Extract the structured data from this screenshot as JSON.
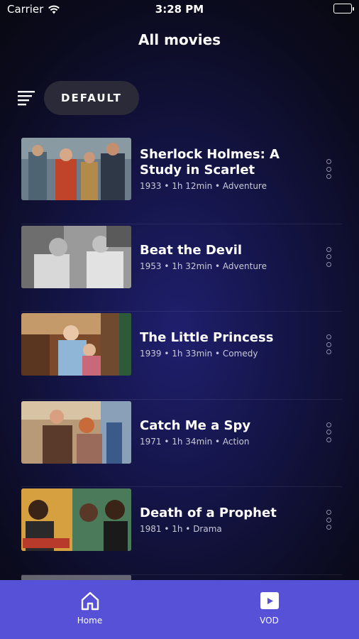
{
  "status_bar": {
    "carrier": "Carrier",
    "time": "3:28 PM"
  },
  "header": {
    "title": "All movies"
  },
  "filter": {
    "sort_label": "DEFAULT"
  },
  "movies": [
    {
      "title": "Sherlock Holmes: A Study in Scarlet",
      "meta": "1933 • 1h 12min • Adventure"
    },
    {
      "title": "Beat the Devil",
      "meta": "1953 • 1h 32min • Adventure"
    },
    {
      "title": "The Little Princess",
      "meta": "1939 • 1h 33min • Comedy"
    },
    {
      "title": "Catch Me a Spy",
      "meta": "1971 • 1h 34min • Action"
    },
    {
      "title": "Death of a Prophet",
      "meta": "1981 • 1h • Drama"
    }
  ],
  "tabs": [
    {
      "label": "Home",
      "icon": "home-icon"
    },
    {
      "label": "VOD",
      "icon": "vod-icon"
    }
  ],
  "colors": {
    "tab_bar": "#5651d6",
    "pill": "#2a2a38"
  }
}
